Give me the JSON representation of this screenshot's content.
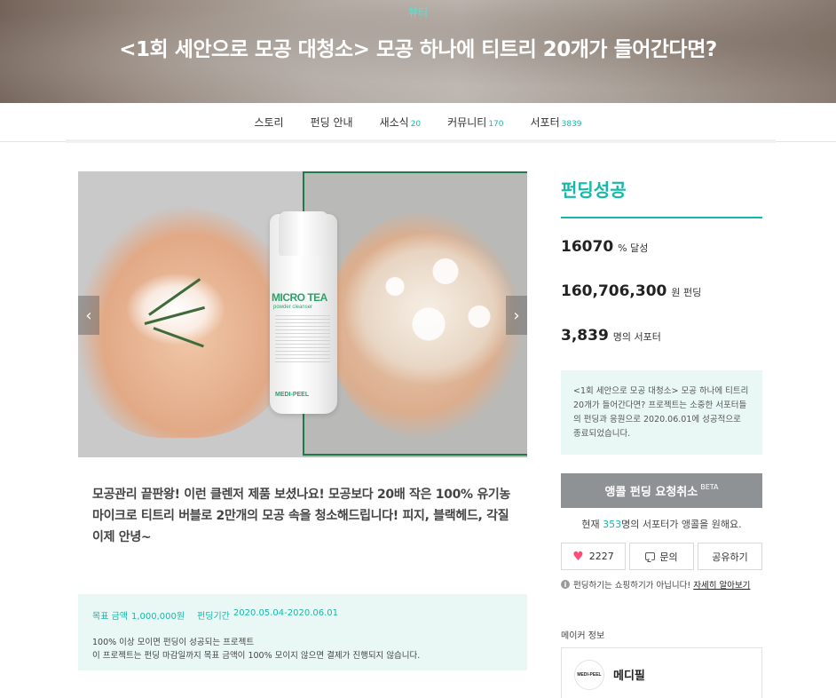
{
  "hero": {
    "category": "뷰티",
    "title": "<1회 세안으로 모공 대청소> 모공 하나에 티트리 20개가 들어간다면?"
  },
  "tabs": [
    {
      "label": "스토리",
      "count": ""
    },
    {
      "label": "펀딩 안내",
      "count": ""
    },
    {
      "label": "새소식",
      "count": "20"
    },
    {
      "label": "커뮤니티",
      "count": "170"
    },
    {
      "label": "서포터",
      "count": "3839"
    }
  ],
  "product_image": {
    "brand": "MICRO TEA",
    "subtitle": "powder cleanser",
    "logo": "MEDI-PEEL",
    "prev_arrow": "‹",
    "next_arrow": "›"
  },
  "summary": "모공관리 끝판왕! 이런 클렌저 제품 보셨나요! 모공보다 20배 작은 100% 유기농 마이크로 티트리 버블로 2만개의 모공 속을 청소해드립니다! 피지, 블랙헤드, 각질 이제 안녕~",
  "goal": {
    "target_label": "목표 금액",
    "target_value": "1,000,000원",
    "period_label": "펀딩기간",
    "period_value": "2020.05.04-2020.06.01",
    "note_line1": "100% 이상 모이면 펀딩이 성공되는 프로젝트",
    "note_line2": "이 프로젝트는 펀딩 마감일까지 목표 금액이 100% 모이지 않으면 결제가 진행되지 않습니다."
  },
  "sidebar": {
    "status": "펀딩성공",
    "achieved_value": "16070",
    "achieved_unit": "% 달성",
    "funded_value": "160,706,300",
    "funded_unit": "원 펀딩",
    "supporters_value": "3,839",
    "supporters_unit": "명의 서포터",
    "result_text": "<1회 세안으로 모공 대청소> 모공 하나에 티트리 20개가 들어간다면? 프로젝트는 소중한 서포터들의 펀딩과 응원으로 2020.06.01에 성공적으로 종료되었습니다.",
    "encore_button": "앵콜 펀딩 요청취소",
    "encore_badge": "BETA",
    "encore_prefix": "현재",
    "encore_count": "353",
    "encore_suffix": "명의 서포터가 앵콜을 원해요.",
    "like_count": "2227",
    "inquiry_label": "문의",
    "share_label": "공유하기",
    "notice_text": "펀딩하기는 쇼핑하기가 아닙니다!",
    "notice_link": "자세히 알아보기",
    "maker_label": "메이커 정보",
    "maker_logo_text": "MEDI-PEEL",
    "maker_name": "메디필"
  },
  "colors": {
    "accent": "#16b8a9",
    "mint_bg": "#eaf8f5",
    "encore_button_bg": "#8e9295",
    "heart": "#ff4d7a"
  }
}
